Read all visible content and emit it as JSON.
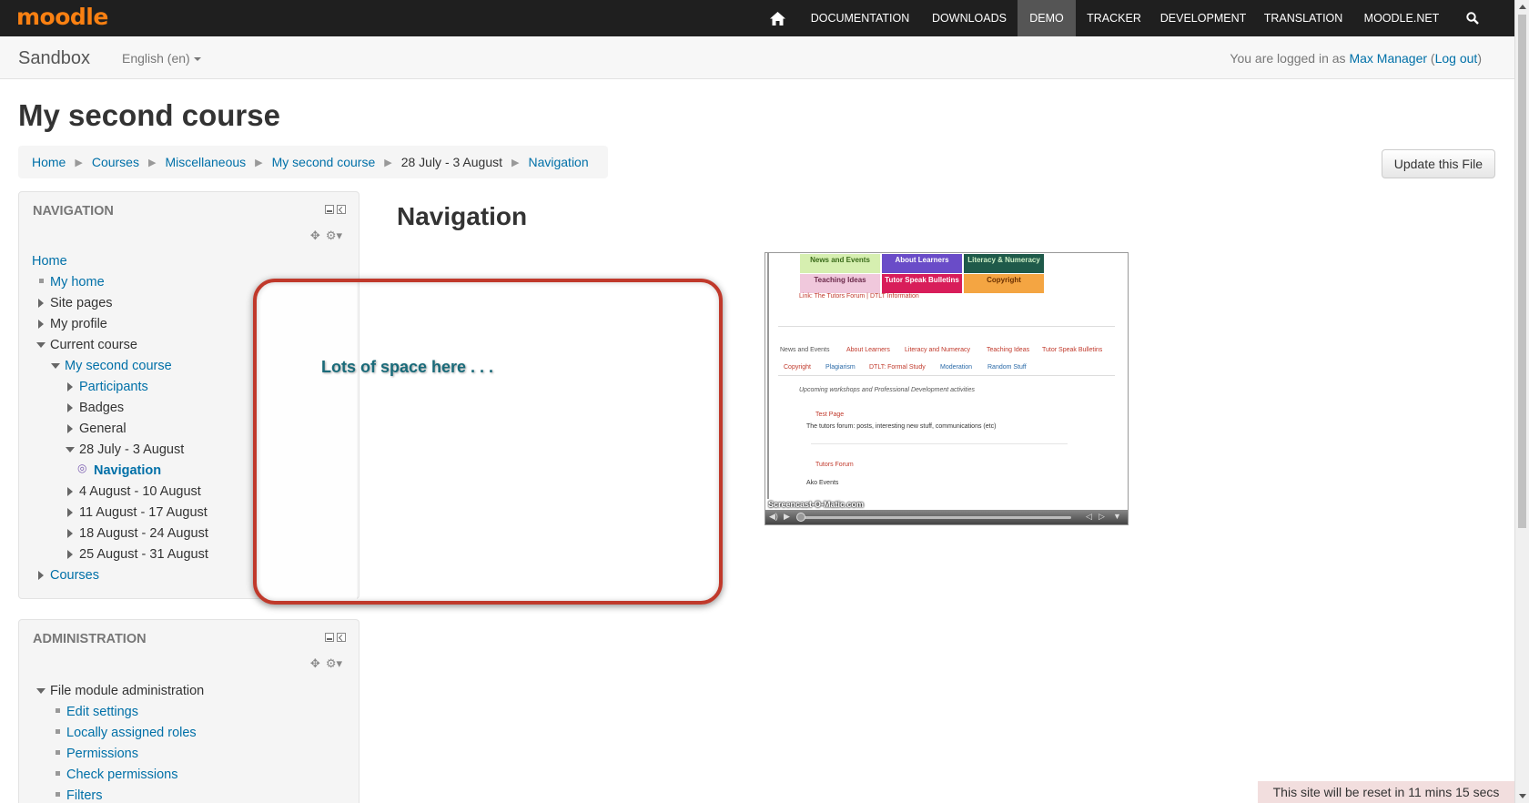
{
  "topbar": {
    "logo": "moodle",
    "nav": [
      "DOCUMENTATION",
      "DOWNLOADS",
      "DEMO",
      "TRACKER",
      "DEVELOPMENT",
      "TRANSLATION",
      "MOODLE.NET"
    ]
  },
  "subbar": {
    "site_name": "Sandbox",
    "language": "English (en)",
    "login_prefix": "You are logged in as",
    "user_name": "Max Manager",
    "logout": "Log out"
  },
  "page": {
    "title": "My second course",
    "breadcrumb": [
      "Home",
      "Courses",
      "Miscellaneous",
      "My second course",
      "28 July - 3 August",
      "Navigation"
    ],
    "update_button": "Update this File",
    "heading": "Navigation"
  },
  "navigation_block": {
    "title": "NAVIGATION",
    "items": [
      "Home",
      "My home",
      "Site pages",
      "My profile",
      "Current course",
      "My second course",
      "Participants",
      "Badges",
      "General",
      "28 July - 3 August",
      "Navigation",
      "4 August - 10 August",
      "11 August - 17 August",
      "18 August - 24 August",
      "25 August - 31 August",
      "Courses"
    ]
  },
  "admin_block": {
    "title": "ADMINISTRATION",
    "items": [
      "File module administration",
      "Edit settings",
      "Locally assigned roles",
      "Permissions",
      "Check permissions",
      "Filters"
    ]
  },
  "annotation": {
    "text": "Lots of space here . . ."
  },
  "video": {
    "tiles": [
      "News and Events",
      "About Learners",
      "Literacy & Numeracy",
      "Teaching Ideas",
      "Tutor Speak Bulletins",
      "Copyright"
    ],
    "link_line": "Link: The Tutors Forum | DTLT Information",
    "tabs": [
      "News and Events",
      "About Learners",
      "Literacy and Numeracy",
      "Teaching Ideas",
      "Tutor Speak Bulletins",
      "Copyright",
      "Plagiarism",
      "DTLT: Formal Study",
      "Moderation",
      "Random Stuff"
    ],
    "subtitle": "Upcoming workshops and Professional Development activities",
    "test_page": "Test Page",
    "forum_desc": "The tutors forum: posts, interesting new stuff, communications (etc)",
    "tutors_forum": "Tutors Forum",
    "ako_events": "Ako Events",
    "watermark": "Screencast-O-Matic.com"
  },
  "footer": {
    "reset_notice": "This site will be reset in 11 mins 15 secs"
  }
}
